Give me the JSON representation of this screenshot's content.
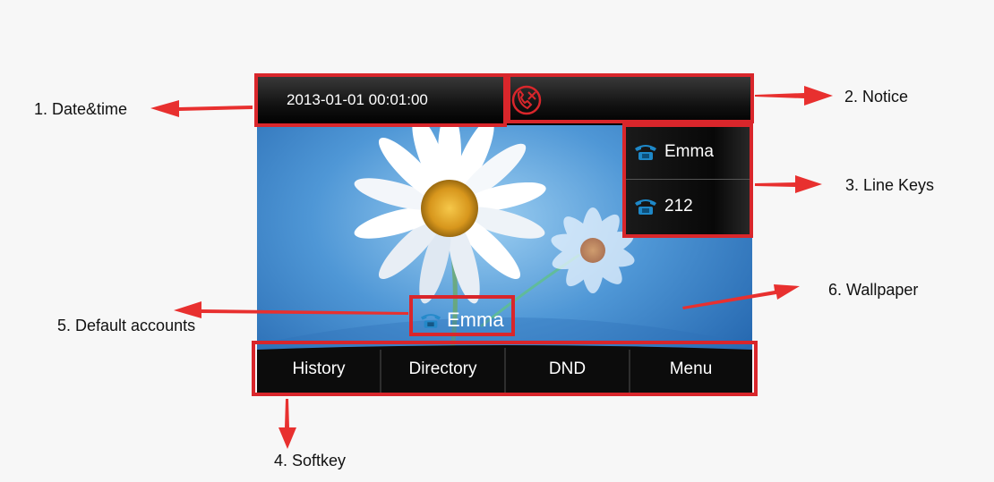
{
  "screen": {
    "datetime": "2013-01-01 00:01:00",
    "line_keys": [
      {
        "label": "Emma",
        "icon": "phone-icon"
      },
      {
        "label": "212",
        "icon": "phone-icon"
      }
    ],
    "default_account": {
      "label": "Emma",
      "icon": "phone-icon"
    },
    "softkeys": [
      "History",
      "Directory",
      "DND",
      "Menu"
    ],
    "notice_icon": "missed-call-notice-icon"
  },
  "callouts": {
    "datetime": "1. Date&time",
    "notice": "2. Notice",
    "line_keys": "3. Line Keys",
    "softkey": "4. Softkey",
    "default_accounts": "5. Default accounts",
    "wallpaper": "6. Wallpaper"
  },
  "colors": {
    "callout_red": "#d9262b",
    "phone_icon_blue": "#1e88c8",
    "wallpaper_blue": "#3a7fc4"
  }
}
